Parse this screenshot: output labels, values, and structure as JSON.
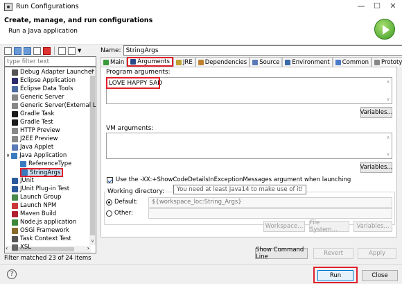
{
  "window": {
    "title": "Run Configurations",
    "minimize_glyph": "—",
    "maximize_glyph": "☐",
    "close_glyph": "✕"
  },
  "header": {
    "title": "Create, manage, and run configurations",
    "subtitle": "Run a Java application"
  },
  "left": {
    "filter_placeholder": "type filter text",
    "status": "Filter matched 23 of 24 items",
    "tree": [
      {
        "label": "Debug Adapter Launcher",
        "icon": "debug-adapter-icon",
        "color": "#555555",
        "indent": 1
      },
      {
        "label": "Eclipse Application",
        "icon": "eclipse-icon",
        "color": "#2c2c6c",
        "indent": 1
      },
      {
        "label": "Eclipse Data Tools",
        "icon": "data-tools-icon",
        "color": "#4a6aa0",
        "indent": 1
      },
      {
        "label": "Generic Server",
        "icon": "server-icon",
        "color": "#888888",
        "indent": 1
      },
      {
        "label": "Generic Server(External Lau",
        "icon": "server-icon",
        "color": "#888888",
        "indent": 1
      },
      {
        "label": "Gradle Task",
        "icon": "gradle-icon",
        "color": "#1a1a1a",
        "indent": 1
      },
      {
        "label": "Gradle Test",
        "icon": "gradle-icon",
        "color": "#1a1a1a",
        "indent": 1
      },
      {
        "label": "HTTP Preview",
        "icon": "http-preview-icon",
        "color": "#888888",
        "indent": 1
      },
      {
        "label": "J2EE Preview",
        "icon": "j2ee-preview-icon",
        "color": "#888888",
        "indent": 1
      },
      {
        "label": "Java Applet",
        "icon": "applet-icon",
        "color": "#5a7ab8",
        "indent": 1
      },
      {
        "label": "Java Application",
        "icon": "java-app-icon",
        "color": "#3a7abf",
        "indent": 0,
        "expander": "∨"
      },
      {
        "label": "ReferenceType",
        "icon": "java-app-icon",
        "color": "#3a7abf",
        "indent": 2
      },
      {
        "label": "StringArgs",
        "icon": "java-app-icon",
        "color": "#3a7abf",
        "indent": 2,
        "selected": true
      },
      {
        "label": "JUnit",
        "icon": "junit-icon",
        "color": "#2a5a9a",
        "indent": 1
      },
      {
        "label": "JUnit Plug-in Test",
        "icon": "junit-plugin-icon",
        "color": "#2a5a9a",
        "indent": 1
      },
      {
        "label": "Launch Group",
        "icon": "launch-group-icon",
        "color": "#4a8a4a",
        "indent": 1
      },
      {
        "label": "Launch NPM",
        "icon": "npm-icon",
        "color": "#cb3837",
        "indent": 1
      },
      {
        "label": "Maven Build",
        "icon": "maven-icon",
        "color": "#b02030",
        "indent": 1
      },
      {
        "label": "Node.js application",
        "icon": "nodejs-icon",
        "color": "#3c873a",
        "indent": 1
      },
      {
        "label": "OSGi Framework",
        "icon": "osgi-icon",
        "color": "#8a6a2a",
        "indent": 1
      },
      {
        "label": "Task Context Test",
        "icon": "task-context-icon",
        "color": "#555555",
        "indent": 1
      },
      {
        "label": "XSL",
        "icon": "xsl-icon",
        "color": "#666666",
        "indent": 1
      }
    ]
  },
  "config": {
    "name_label": "Name:",
    "name_value": "StringArgs",
    "tabs": [
      {
        "label": "Main",
        "icon": "main-tab-icon",
        "color": "#3a9a3a"
      },
      {
        "label": "Arguments",
        "icon": "arguments-tab-icon",
        "color": "#2a4a8a",
        "active": true
      },
      {
        "label": "JRE",
        "icon": "jre-tab-icon",
        "color": "#c0a030"
      },
      {
        "label": "Dependencies",
        "icon": "dependencies-tab-icon",
        "color": "#c08030"
      },
      {
        "label": "Source",
        "icon": "source-tab-icon",
        "color": "#5a7ab8"
      },
      {
        "label": "Environment",
        "icon": "environment-tab-icon",
        "color": "#3a6aa8"
      },
      {
        "label": "Common",
        "icon": "common-tab-icon",
        "color": "#4a7ac8"
      },
      {
        "label": "Prototype",
        "icon": "prototype-tab-icon",
        "color": "#888888"
      }
    ],
    "program_args_label": "Program arguments:",
    "program_args_value": "LOVE HAPPY SAD",
    "vm_args_label": "VM arguments:",
    "vm_args_value": "",
    "variables_label": "Variables...",
    "show_code_details_label": "Use the -XX:+ShowCodeDetailsInExceptionMessages argument when launching",
    "tooltip": "You need at least Java14 to make use of it!",
    "working_directory_label": "Working directory:",
    "default_label": "Default:",
    "default_value": "${workspace_loc:String_Args}",
    "other_label": "Other:",
    "workspace_button": "Workspace...",
    "file_system_button": "File System...",
    "wd_variables_button": "Variables...",
    "show_command_line": "Show Command Line",
    "revert": "Revert",
    "apply": "Apply"
  },
  "footer": {
    "run": "Run",
    "close": "Close",
    "help_glyph": "?"
  }
}
